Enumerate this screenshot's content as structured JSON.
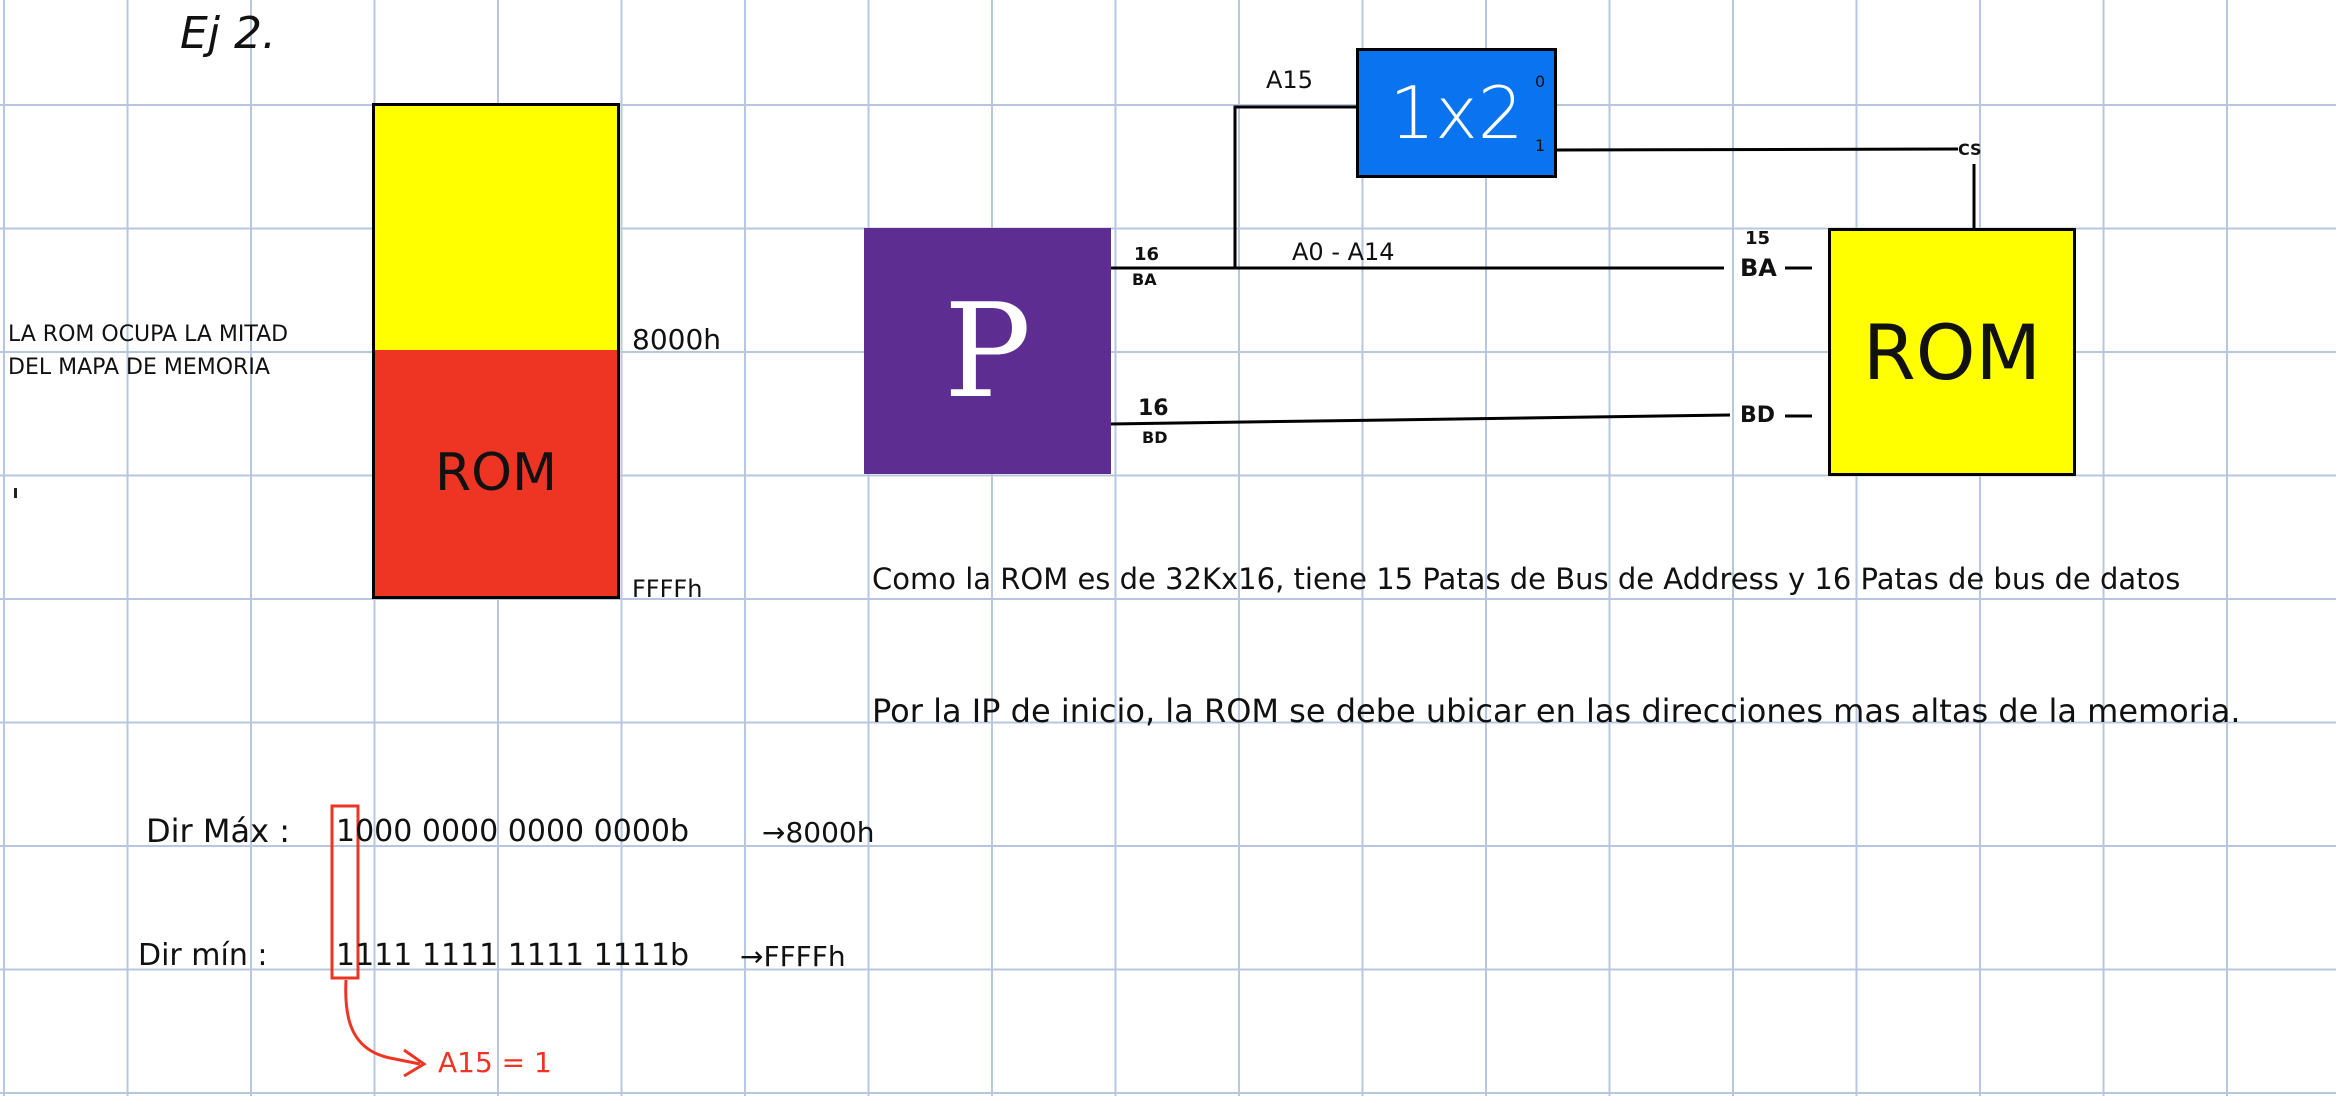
{
  "page": {
    "title": "Ej 2."
  },
  "memory_map": {
    "note_line1": "LA ROM OCUPA LA MITAD",
    "note_line2": "DEL MAPA DE MEMORIA",
    "rom_label": "ROM",
    "addr_mid": "8000h",
    "addr_end": "FFFFh",
    "colors": {
      "free": "#ffff00",
      "rom": "#ee3524"
    }
  },
  "circuit": {
    "processor_label": "P",
    "decoder_label": "1x2",
    "decoder_out0": "0",
    "decoder_out1": "1",
    "a15_label": "A15",
    "cs_label": "CS",
    "rom_label": "ROM",
    "ba_width": "16",
    "ba_label": "BA",
    "bd_width": "16",
    "bd_label": "BD",
    "addr_bus_label": "A0 - A14",
    "rom_ba_width": "15",
    "rom_ba_label": "BA",
    "rom_bd_label": "BD",
    "colors": {
      "processor": "#5e2d91",
      "decoder": "#0a74f0",
      "rom": "#ffff00"
    }
  },
  "notes": {
    "line1": "Como la ROM es de 32Kx16, tiene 15 Patas de Bus de Address y 16 Patas de bus de datos",
    "line2": "Por la IP de inicio, la ROM se debe ubicar en las direcciones mas altas de la memoria."
  },
  "addresses": {
    "max_label": "Dir Máx :",
    "max_value": "1000 0000 0000 0000b",
    "max_hex": "→8000h",
    "min_label": "Dir mín :",
    "min_value": "1111 1111 1111 1111b",
    "min_hex": "→FFFFh",
    "a15_result": "A15 = 1",
    "highlight_color": "#ee3524"
  }
}
